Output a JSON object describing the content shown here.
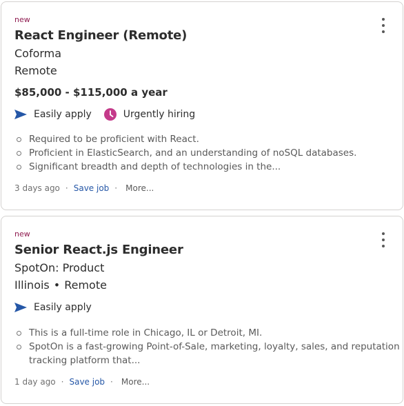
{
  "jobs": [
    {
      "new_label": "new",
      "title": "React Engineer (Remote)",
      "company": "Coforma",
      "location": "Remote",
      "location_suffix": "",
      "salary": "$85,000 - $115,000 a year",
      "easily_apply": "Easily apply",
      "urgently_hiring": "Urgently hiring",
      "bullets": [
        "Required to be proficient with React.",
        "Proficient in ElasticSearch, and an understanding of noSQL databases.",
        "Significant breadth and depth of technologies in the..."
      ],
      "posted": "3 days ago",
      "save_label": "Save job",
      "more_label": "More..."
    },
    {
      "new_label": "new",
      "title": "Senior React.js Engineer",
      "company": "SpotOn: Product",
      "location": "Illinois",
      "location_suffix": "Remote",
      "easily_apply": "Easily apply",
      "bullets": [
        "This is a full-time role in Chicago, IL or Detroit, MI.",
        "SpotOn is a fast-growing Point-of-Sale, marketing, loyalty, sales, and reputation",
        "tracking platform that..."
      ],
      "posted": "1 day ago",
      "save_label": "Save job",
      "more_label": "More..."
    }
  ],
  "separator": "·",
  "location_dot": "•",
  "colors": {
    "new_label": "#8f1c50",
    "apply_icon": "#2557a7",
    "urgent_icon": "#c43a8a",
    "link": "#2557a7"
  },
  "icons": {
    "apply": "paper-plane-icon",
    "urgent": "clock-icon",
    "menu": "kebab-menu-icon"
  }
}
